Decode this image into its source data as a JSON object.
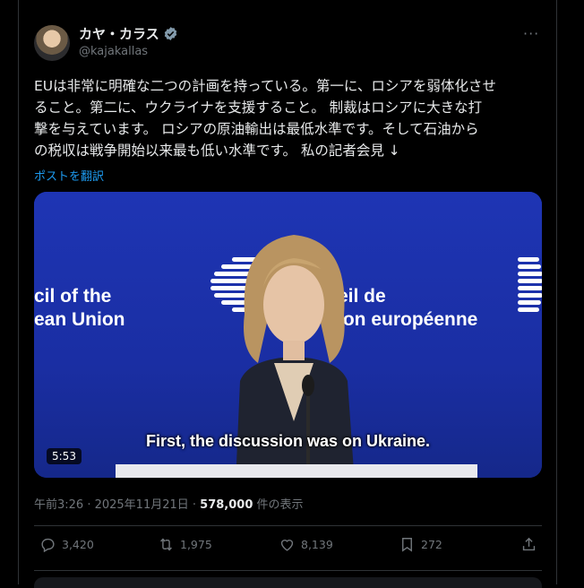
{
  "author": {
    "name": "カヤ・カラス",
    "handle": "@kajakallas",
    "verified_color": "#829aab"
  },
  "more_label": "···",
  "tweet": {
    "lines": [
      "EUは非常に明確な二つの計画を持っている。第一に、ロシアを弱体化させ",
      "ること。第二に、ウクライナを支援すること。 制裁はロシアに大きな打",
      "撃を与えています。 ロシアの原油輸出は最低水準です。そして石油から",
      "の税収は戦争開始以来最も低い水準です。 私の記者会見 ↓"
    ],
    "translate_label": "ポストを翻訳"
  },
  "video": {
    "sign_left": [
      "cil of the",
      "ean Union"
    ],
    "sign_right": [
      "eil de",
      "ion européenne"
    ],
    "caption": "First, the discussion was on Ukraine.",
    "duration": "5:53"
  },
  "meta": {
    "time": "午前3:26 · 2025年11月21日 · ",
    "views": "578,000",
    "views_suffix": " 件の表示"
  },
  "actions": {
    "replies": "3,420",
    "reposts": "1,975",
    "likes": "8,139",
    "bookmarks": "272"
  },
  "colors": {
    "background": "#000000",
    "text": "#e7e9ea",
    "muted": "#71767b",
    "link": "#1d9bf0",
    "border": "#2f3336"
  }
}
